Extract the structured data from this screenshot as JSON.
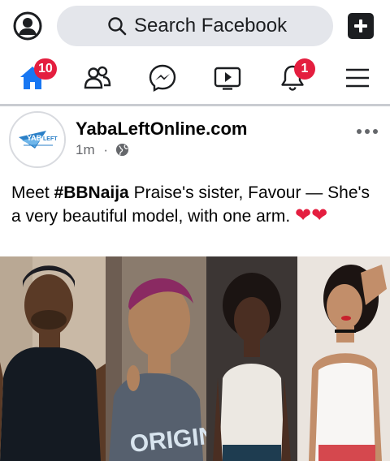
{
  "colors": {
    "accent": "#1877f2",
    "badge": "#e41e3f",
    "search_bg": "#e4e6eb",
    "secondary_text": "#65676b"
  },
  "header": {
    "search_placeholder": "Search Facebook",
    "profile_icon": "user-circle-icon",
    "create_icon": "plus-square-icon"
  },
  "nav": {
    "items": [
      {
        "name": "home",
        "icon": "home-icon",
        "badge": "10",
        "active": true
      },
      {
        "name": "friends",
        "icon": "friends-icon",
        "badge": ""
      },
      {
        "name": "messenger",
        "icon": "messenger-icon",
        "badge": ""
      },
      {
        "name": "watch",
        "icon": "video-play-icon",
        "badge": ""
      },
      {
        "name": "notifications",
        "icon": "bell-icon",
        "badge": "1"
      },
      {
        "name": "menu",
        "icon": "hamburger-menu-icon",
        "badge": ""
      }
    ]
  },
  "post": {
    "page_name": "YabaLeftOnline.com",
    "avatar_logo_text": "YABA LEFT",
    "time": "1m",
    "separator": "·",
    "privacy_icon": "globe-icon",
    "text_prefix": "Meet ",
    "hashtag": "#BBNaija",
    "text_body": " Praise's sister, Favour — She's a very beautiful model, with one arm. ",
    "emoji": "❤❤",
    "photo_panels": 4
  }
}
